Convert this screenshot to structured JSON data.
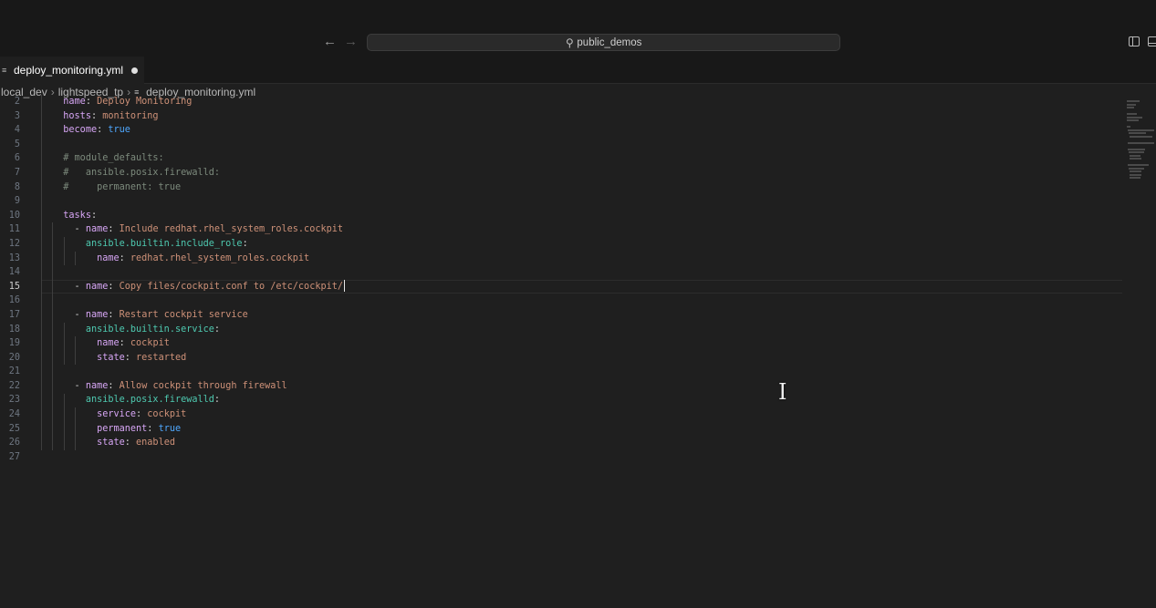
{
  "titlebar": {
    "search_label": "public_demos"
  },
  "tab": {
    "label": "deploy_monitoring.yml",
    "dirty": true
  },
  "breadcrumb": [
    "local_dev",
    "lightspeed_tp",
    "deploy_monitoring.yml"
  ],
  "editor": {
    "current_line": 15,
    "lines": [
      {
        "n": "2",
        "text": "  name: Deploy Monitoring"
      },
      {
        "n": "3",
        "text": "  hosts: monitoring"
      },
      {
        "n": "4",
        "text": "  become: true"
      },
      {
        "n": "5",
        "text": ""
      },
      {
        "n": "6",
        "text": "  # module_defaults:"
      },
      {
        "n": "7",
        "text": "  #   ansible.posix.firewalld:"
      },
      {
        "n": "8",
        "text": "  #     permanent: true"
      },
      {
        "n": "9",
        "text": ""
      },
      {
        "n": "10",
        "text": "  tasks:"
      },
      {
        "n": "11",
        "text": "    - name: Include redhat.rhel_system_roles.cockpit"
      },
      {
        "n": "12",
        "text": "      ansible.builtin.include_role:"
      },
      {
        "n": "13",
        "text": "        name: redhat.rhel_system_roles.cockpit"
      },
      {
        "n": "14",
        "text": ""
      },
      {
        "n": "15",
        "text": "    - name: Copy files/cockpit.conf to /etc/cockpit/"
      },
      {
        "n": "16",
        "text": ""
      },
      {
        "n": "17",
        "text": "    - name: Restart cockpit service"
      },
      {
        "n": "18",
        "text": "      ansible.builtin.service:"
      },
      {
        "n": "19",
        "text": "        name: cockpit"
      },
      {
        "n": "20",
        "text": "        state: restarted"
      },
      {
        "n": "21",
        "text": ""
      },
      {
        "n": "22",
        "text": "    - name: Allow cockpit through firewall"
      },
      {
        "n": "23",
        "text": "      ansible.posix.firewalld:"
      },
      {
        "n": "24",
        "text": "        service: cockpit"
      },
      {
        "n": "25",
        "text": "        permanent: true"
      },
      {
        "n": "26",
        "text": "        state: enabled"
      },
      {
        "n": "27",
        "text": ""
      }
    ]
  },
  "colors": {
    "keyword": "#d7a6f5",
    "module": "#4ec9b0",
    "string": "#ce9178",
    "boolean": "#4fa8ff",
    "comment": "#7c8a7c",
    "background": "#1f1f1f"
  },
  "icons": [
    "arrow-left-icon",
    "arrow-right-icon",
    "search-icon",
    "toggle-sidebar-icon",
    "toggle-panel-icon",
    "file-icon",
    "text-cursor-icon"
  ]
}
